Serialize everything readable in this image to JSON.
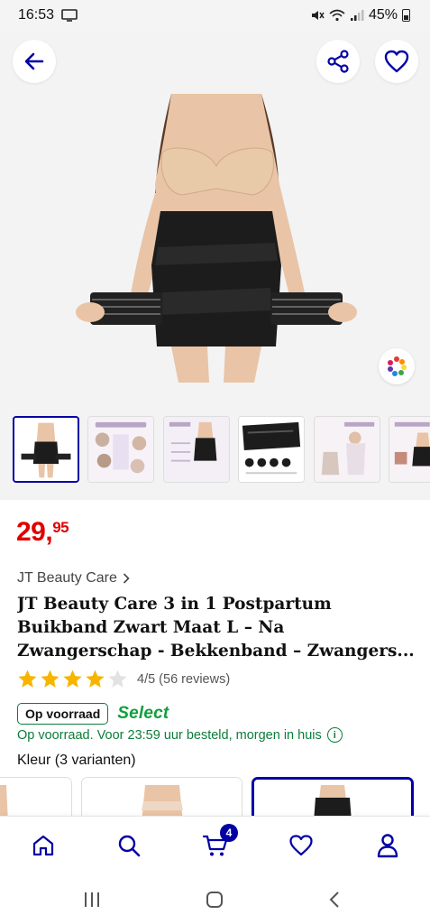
{
  "status_bar": {
    "time": "16:53",
    "battery": "45%"
  },
  "product": {
    "price_main": "29,",
    "price_cents": "95",
    "brand": "JT Beauty Care",
    "title_lines": [
      "JT Beauty Care 3 in 1 Postpartum",
      "Buikband Zwart Maat L – Na",
      "Zwangerschap - Bekkenband – Zwangers..."
    ],
    "rating": {
      "value": 4,
      "max": 5,
      "text": "4/5 (56 reviews)"
    },
    "stock_badge": "Op voorraad",
    "select_label": "Select",
    "delivery": "Op voorraad. Voor 23:59 uur besteld, morgen in huis",
    "variants_label": "Kleur (3 varianten)"
  },
  "thumbnails": {
    "count": 6,
    "selected_index": 0
  },
  "bottom_nav": {
    "items": [
      "home-icon",
      "search-icon",
      "cart-icon",
      "heart-icon",
      "account-icon"
    ],
    "cart_count": "4"
  },
  "colors": {
    "brand_blue": "#0000a4",
    "price_red": "#e00000",
    "stock_green": "#0d7d3a",
    "select_green": "#0f9f3e",
    "star_yellow": "#f7b500"
  }
}
